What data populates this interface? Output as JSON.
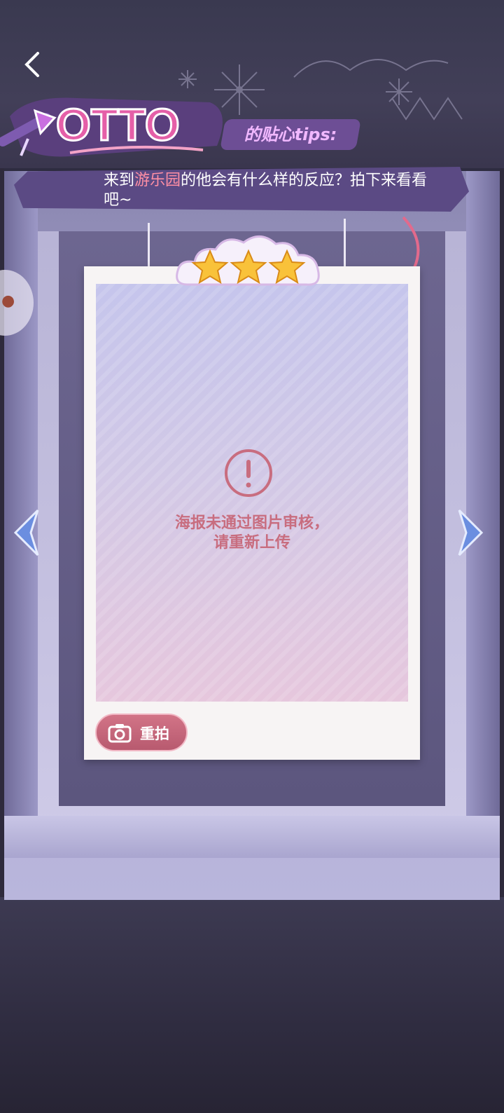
{
  "header": {
    "logo_text": "OTTO",
    "tips_label": "的贴心tips:",
    "tip_prefix": "来到",
    "tip_highlight": "游乐园",
    "tip_suffix": "的他会有什么样的反应？拍下来看看吧~"
  },
  "card": {
    "stars": 3,
    "error_line1": "海报未通过图片审核，",
    "error_line2": "请重新上传",
    "retake_label": "重拍"
  },
  "icons": {
    "back": "back-chevron-icon",
    "warning": "exclamation-circle-icon",
    "camera": "camera-retake-icon",
    "prev": "chevron-left-icon",
    "next": "chevron-right-icon",
    "star": "star-icon"
  },
  "colors": {
    "accent_pink": "#ff8fa4",
    "error_text": "#c86d7f",
    "button": "#c4667a",
    "banner": "#5b4a84"
  }
}
